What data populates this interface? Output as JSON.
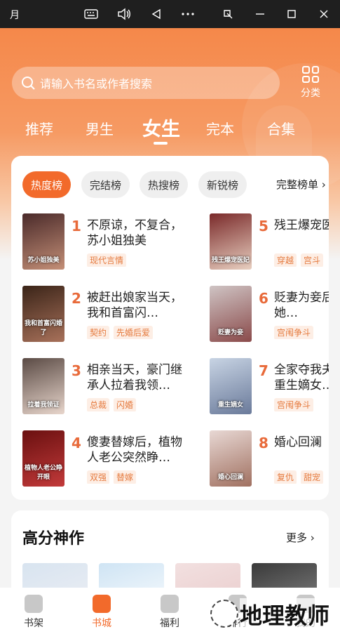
{
  "window": {
    "title": "月",
    "buttons": [
      "keyboard-icon",
      "volume-icon",
      "back-icon",
      "more-icon",
      "screenshot-icon",
      "minimize-icon",
      "maximize-icon",
      "close-icon"
    ]
  },
  "colors": {
    "accent": "#f26a2b",
    "header": "#f5884a",
    "tag_bg": "#fdeee5",
    "tag_text": "#e57a3e"
  },
  "search": {
    "placeholder": "请输入书名或作者搜索"
  },
  "category": {
    "label": "分类"
  },
  "tabs": [
    {
      "label": "推荐"
    },
    {
      "label": "男生"
    },
    {
      "label": "女生",
      "active": true
    },
    {
      "label": "完本"
    },
    {
      "label": "合集"
    }
  ],
  "chips": [
    {
      "label": "热度榜",
      "active": true
    },
    {
      "label": "完结榜"
    },
    {
      "label": "热搜榜"
    },
    {
      "label": "新锐榜"
    }
  ],
  "full_list": "完整榜单",
  "books": [
    {
      "rank": "1",
      "title": "不原谅，不复合，苏小姐独美",
      "tags": [
        "现代言情"
      ],
      "cover_text": "苏小姐独美",
      "c1": "#4a2a2a",
      "c2": "#c48f77"
    },
    {
      "rank": "2",
      "title": "被赶出娘家当天，我和首富闪…",
      "tags": [
        "契约",
        "先婚后爱"
      ],
      "cover_text": "我和首富闪婚了",
      "c1": "#3a2418",
      "c2": "#a8715a"
    },
    {
      "rank": "3",
      "title": "相亲当天，豪门继承人拉着我领…",
      "tags": [
        "总裁",
        "闪婚"
      ],
      "cover_text": "拉着我领证",
      "c1": "#5a4a44",
      "c2": "#e8d6cc"
    },
    {
      "rank": "4",
      "title": "傻妻替嫁后，植物人老公突然睁…",
      "tags": [
        "双强",
        "替嫁"
      ],
      "cover_text": "植物人老公睁开眼",
      "c1": "#6a1010",
      "c2": "#c23a3a"
    },
    {
      "rank": "5",
      "title": "残王爆宠医妃",
      "tags": [
        "穿越",
        "宫斗"
      ],
      "cover_text": "残王爆宠医妃",
      "c1": "#7a2a2a",
      "c2": "#e8cfc0"
    },
    {
      "rank": "6",
      "title": "贬妻为妾后，大妇她…",
      "tags": [
        "宫闱争斗"
      ],
      "cover_text": "贬妻为妾",
      "c1": "#cfc4c4",
      "c2": "#8a4a4a"
    },
    {
      "rank": "7",
      "title": "全家夺我夫婿后，重生嫡女…",
      "tags": [
        "宫闱争斗"
      ],
      "cover_text": "重生嫡女",
      "c1": "#c8d4e4",
      "c2": "#6a7a9a"
    },
    {
      "rank": "8",
      "title": "婚心回澜",
      "tags": [
        "复仇",
        "甜宠"
      ],
      "cover_text": "婚心回澜",
      "c1": "#e8d8d4",
      "c2": "#a07060"
    }
  ],
  "high_score": {
    "title": "高分神作",
    "more": "更多",
    "covers": [
      {
        "c1": "#d8e4f0",
        "c2": "#f0f0f4"
      },
      {
        "c1": "#cfe4f4",
        "c2": "#ffffff"
      },
      {
        "c1": "#f2e0e0",
        "c2": "#e8c8c8"
      },
      {
        "c1": "#3a3a3a",
        "c2": "#909090"
      }
    ]
  },
  "bottom_nav": [
    {
      "label": "书架"
    },
    {
      "label": "书城",
      "active": true
    },
    {
      "label": "福利"
    },
    {
      "label": "排行"
    },
    {
      "label": "我的"
    }
  ],
  "watermark": {
    "text": "地理教师"
  }
}
